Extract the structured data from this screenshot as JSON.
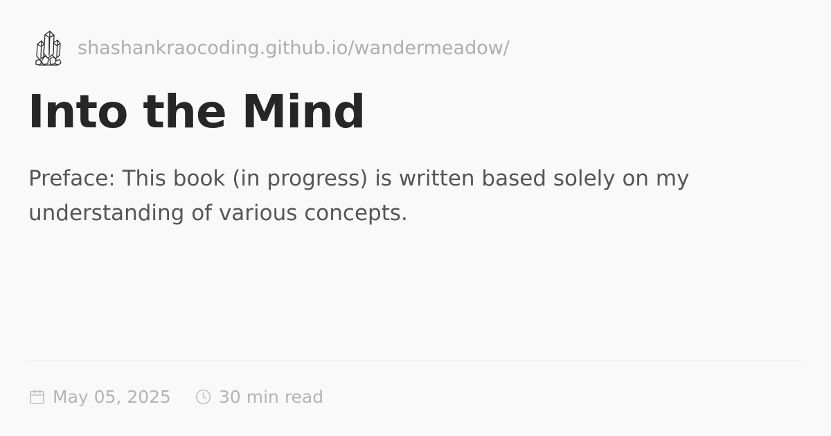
{
  "site": {
    "logo_icon": "crystal-cluster-icon",
    "url": "shashankraocoding.github.io/wandermeadow/"
  },
  "article": {
    "title": "Into the Mind",
    "description": "Preface: This book (in progress) is written based solely on my understanding of various concepts."
  },
  "meta": {
    "date_icon": "calendar-icon",
    "date": "May 05, 2025",
    "read_icon": "clock-icon",
    "read_time": "30 min read"
  },
  "colors": {
    "background": "#faf9fa",
    "title": "#262626",
    "body_text": "#555555",
    "muted_text": "#aeaeae",
    "divider": "#e6e5e6"
  }
}
